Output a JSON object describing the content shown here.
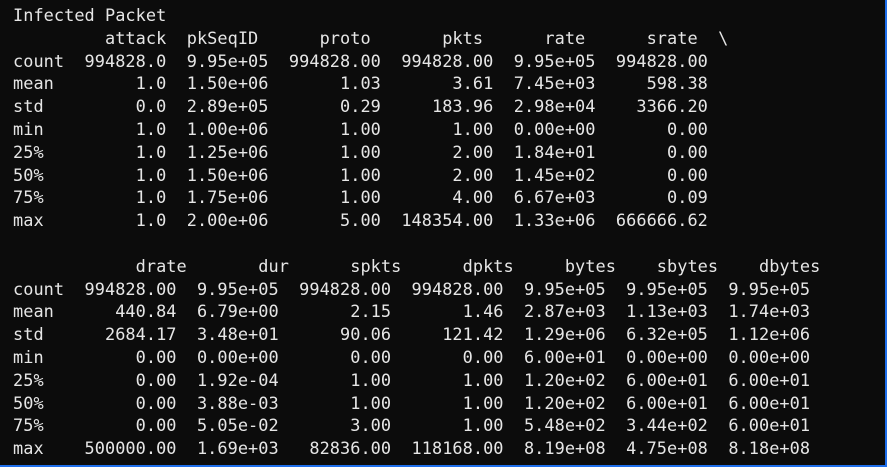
{
  "terminal": {
    "title_line": "Infected Packet",
    "lines": [
      "         attack  pkSeqID      proto       pkts      rate      srate  \\",
      "count  994828.0  9.95e+05  994828.00  994828.00  9.95e+05  994828.00",
      "mean        1.0  1.50e+06       1.03       3.61  7.45e+03     598.38",
      "std         0.0  2.89e+05       0.29     183.96  2.98e+04    3366.20",
      "min         1.0  1.00e+06       1.00       1.00  0.00e+00       0.00",
      "25%         1.0  1.25e+06       1.00       2.00  1.84e+01       0.00",
      "50%         1.0  1.50e+06       1.00       2.00  1.45e+02       0.00",
      "75%         1.0  1.75e+06       1.00       4.00  6.67e+03       0.09",
      "max         1.0  2.00e+06       5.00  148354.00  1.33e+06  666666.62",
      "",
      "            drate       dur      spkts      dpkts     bytes    sbytes    dbytes",
      "count  994828.00  9.95e+05  994828.00  994828.00  9.95e+05  9.95e+05  9.95e+05",
      "mean      440.84  6.79e+00       2.15       1.46  2.87e+03  1.13e+03  1.74e+03",
      "std      2684.17  3.48e+01      90.06     121.42  1.29e+06  6.32e+05  1.12e+06",
      "min         0.00  0.00e+00       0.00       0.00  6.00e+01  0.00e+00  0.00e+00",
      "25%         0.00  1.92e-04       1.00       1.00  1.20e+02  6.00e+01  6.00e+01",
      "50%         0.00  3.88e-03       1.00       1.00  1.20e+02  6.00e+01  6.00e+01",
      "75%         0.00  5.05e-02       3.00       1.00  5.48e+02  3.44e+02  6.00e+01",
      "max    500000.00  1.69e+03   82836.00  118168.00  8.19e+08  4.75e+08  8.18e+08"
    ]
  },
  "colors": {
    "background": "#0c0c0c",
    "text": "#e6e6e6",
    "window_border": "#1f6feb"
  }
}
